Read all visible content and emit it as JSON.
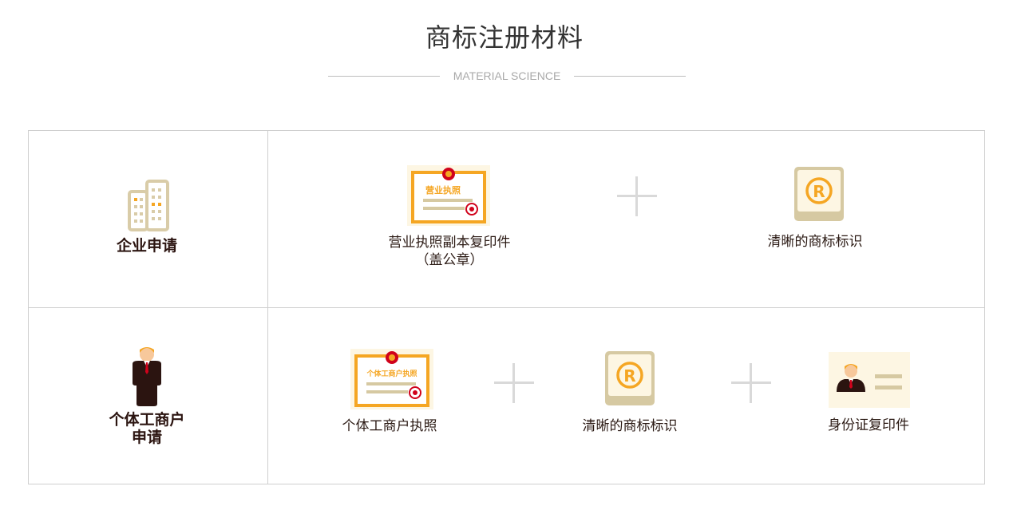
{
  "header": {
    "title": "商标注册材料",
    "subtitle": "MATERIAL SCIENCE"
  },
  "rows": [
    {
      "category": "企业申请",
      "category_icon": "building-icon",
      "items": [
        {
          "label_line1": "营业执照副本复印件",
          "label_line2": "（盖公章）",
          "icon": "business-license-icon",
          "icon_text": "营业执照"
        },
        {
          "label_line1": "清晰的商标标识",
          "icon": "registered-trademark-icon"
        }
      ]
    },
    {
      "category_line1": "个体工商户",
      "category_line2": "申请",
      "category_icon": "person-icon",
      "items": [
        {
          "label_line1": "个体工商户执照",
          "icon": "individual-license-icon",
          "icon_text": "个体工商户执照"
        },
        {
          "label_line1": "清晰的商标标识",
          "icon": "registered-trademark-icon"
        },
        {
          "label_line1": "身份证复印件",
          "icon": "id-card-icon"
        }
      ]
    }
  ],
  "colors": {
    "accent": "#f5a623",
    "beige": "#d6c9a2",
    "dark": "#2b1410",
    "red": "#d0021b"
  }
}
